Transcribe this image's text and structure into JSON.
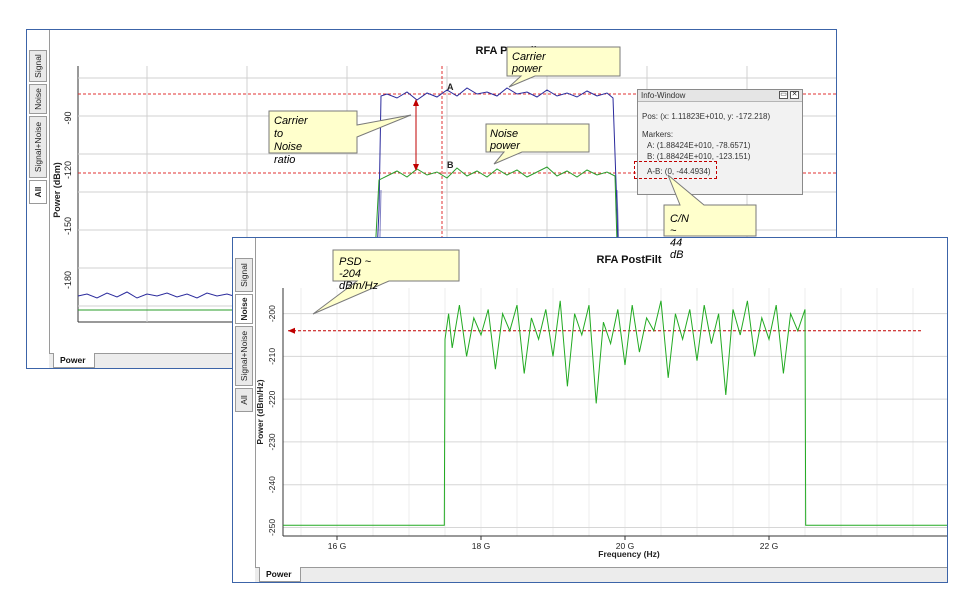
{
  "back_window": {
    "title": "RFA PostFilt",
    "sidebar_tabs": [
      "Signal",
      "Noise",
      "Signal+Noise",
      "All"
    ],
    "bottom_tab": "Power",
    "ylabel": "Power (dBm)",
    "y_ticks": [
      "-90",
      "-120",
      "-150",
      "-180"
    ],
    "marker_a": "A",
    "marker_b": "B"
  },
  "info_window": {
    "title": "Info-Window",
    "pos": "Pos:  (x: 1.11823E+010, y: -172.218)",
    "markers_label": "Markers:",
    "marker_a": "A: (1.88424E+010, -78.6571)",
    "marker_b": "B: (1.88424E+010, -123.151)",
    "diff": "A-B: (0, -44.4934)"
  },
  "front_window": {
    "title": "RFA PostFilt",
    "sidebar_tabs": [
      "Signal",
      "Noise",
      "Signal+Noise",
      "All"
    ],
    "bottom_tab": "Power"
  },
  "callouts": {
    "carrier_power": "Carrier power",
    "cn_ratio_line1": "Carrier to",
    "cn_ratio_line2": "Noise ratio",
    "noise_power": "Noise power",
    "cn_value": "C/N ~ 44 dB",
    "psd": "PSD ~ -204 dBm/Hz"
  },
  "chart_data": {
    "type": "line",
    "title": "RFA PostFilt",
    "xlabel": "Frequency (Hz)",
    "ylabel": "Power (dBm/Hz)",
    "x_tick_labels": [
      "16 G",
      "18 G",
      "20 G",
      "22 G"
    ],
    "y_tick_labels": [
      "-200",
      "-210",
      "-220",
      "-230",
      "-240",
      "-250"
    ],
    "xlim": [
      15.25,
      24.5
    ],
    "ylim": [
      -252,
      -194
    ],
    "x_unit": "GHz",
    "grid": true,
    "reference_level": -204,
    "series": [
      {
        "color": "#22aa22",
        "x": [
          15.25,
          17.49,
          17.5,
          17.55,
          17.6,
          17.7,
          17.8,
          17.9,
          18.0,
          18.1,
          18.2,
          18.3,
          18.4,
          18.5,
          18.6,
          18.7,
          18.8,
          18.9,
          19.0,
          19.1,
          19.2,
          19.3,
          19.4,
          19.5,
          19.6,
          19.7,
          19.8,
          19.9,
          20.0,
          20.1,
          20.2,
          20.3,
          20.4,
          20.5,
          20.6,
          20.7,
          20.8,
          20.9,
          21.0,
          21.1,
          21.2,
          21.3,
          21.4,
          21.5,
          21.6,
          21.7,
          21.8,
          21.9,
          22.0,
          22.1,
          22.2,
          22.3,
          22.4,
          22.5,
          22.51,
          24.5
        ],
        "y": [
          -249.5,
          -249.5,
          -206,
          -200,
          -208,
          -198,
          -210,
          -201,
          -205,
          -199,
          -213,
          -200,
          -204,
          -198,
          -214,
          -201,
          -206,
          -199,
          -210,
          -197,
          -217,
          -200,
          -205,
          -198,
          -221,
          -202,
          -207,
          -199,
          -212,
          -198,
          -209,
          -201,
          -204,
          -197,
          -215,
          -200,
          -206,
          -199,
          -211,
          -198,
          -207,
          -200,
          -219,
          -199,
          -205,
          -197,
          -210,
          -201,
          -206,
          -198,
          -214,
          -200,
          -204,
          -199,
          -249.5,
          -249.5
        ]
      }
    ]
  }
}
